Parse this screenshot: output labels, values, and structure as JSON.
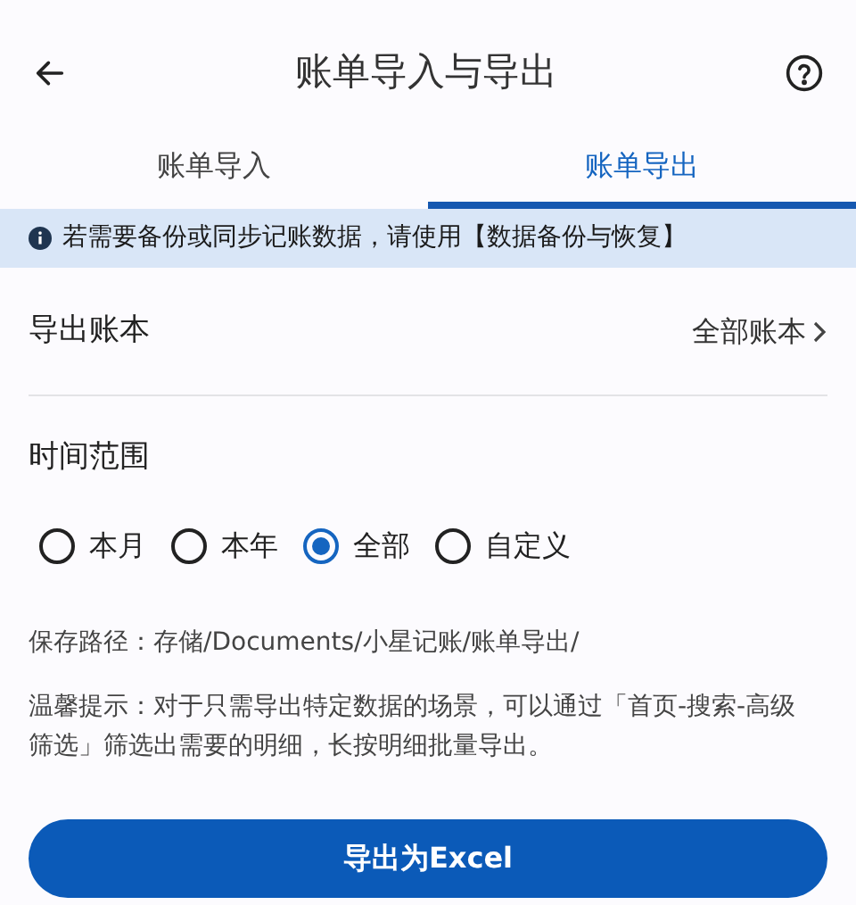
{
  "header": {
    "title": "账单导入与导出"
  },
  "tabs": [
    {
      "label": "账单导入",
      "selected": false
    },
    {
      "label": "账单导出",
      "selected": true
    }
  ],
  "notice": "若需要备份或同步记账数据，请使用【数据备份与恢复】",
  "ledger_row": {
    "label": "导出账本",
    "value": "全部账本"
  },
  "time_range": {
    "label": "时间范围",
    "options": [
      {
        "label": "本月",
        "selected": false
      },
      {
        "label": "本年",
        "selected": false
      },
      {
        "label": "全部",
        "selected": true
      },
      {
        "label": "自定义",
        "selected": false
      }
    ]
  },
  "save_path": "保存路径：存储/Documents/小星记账/账单导出/",
  "tip": "温馨提示：对于只需导出特定数据的场景，可以通过「首页-搜索-高级筛选」筛选出需要的明细，长按明细批量导出。",
  "export_button": "导出为Excel"
}
